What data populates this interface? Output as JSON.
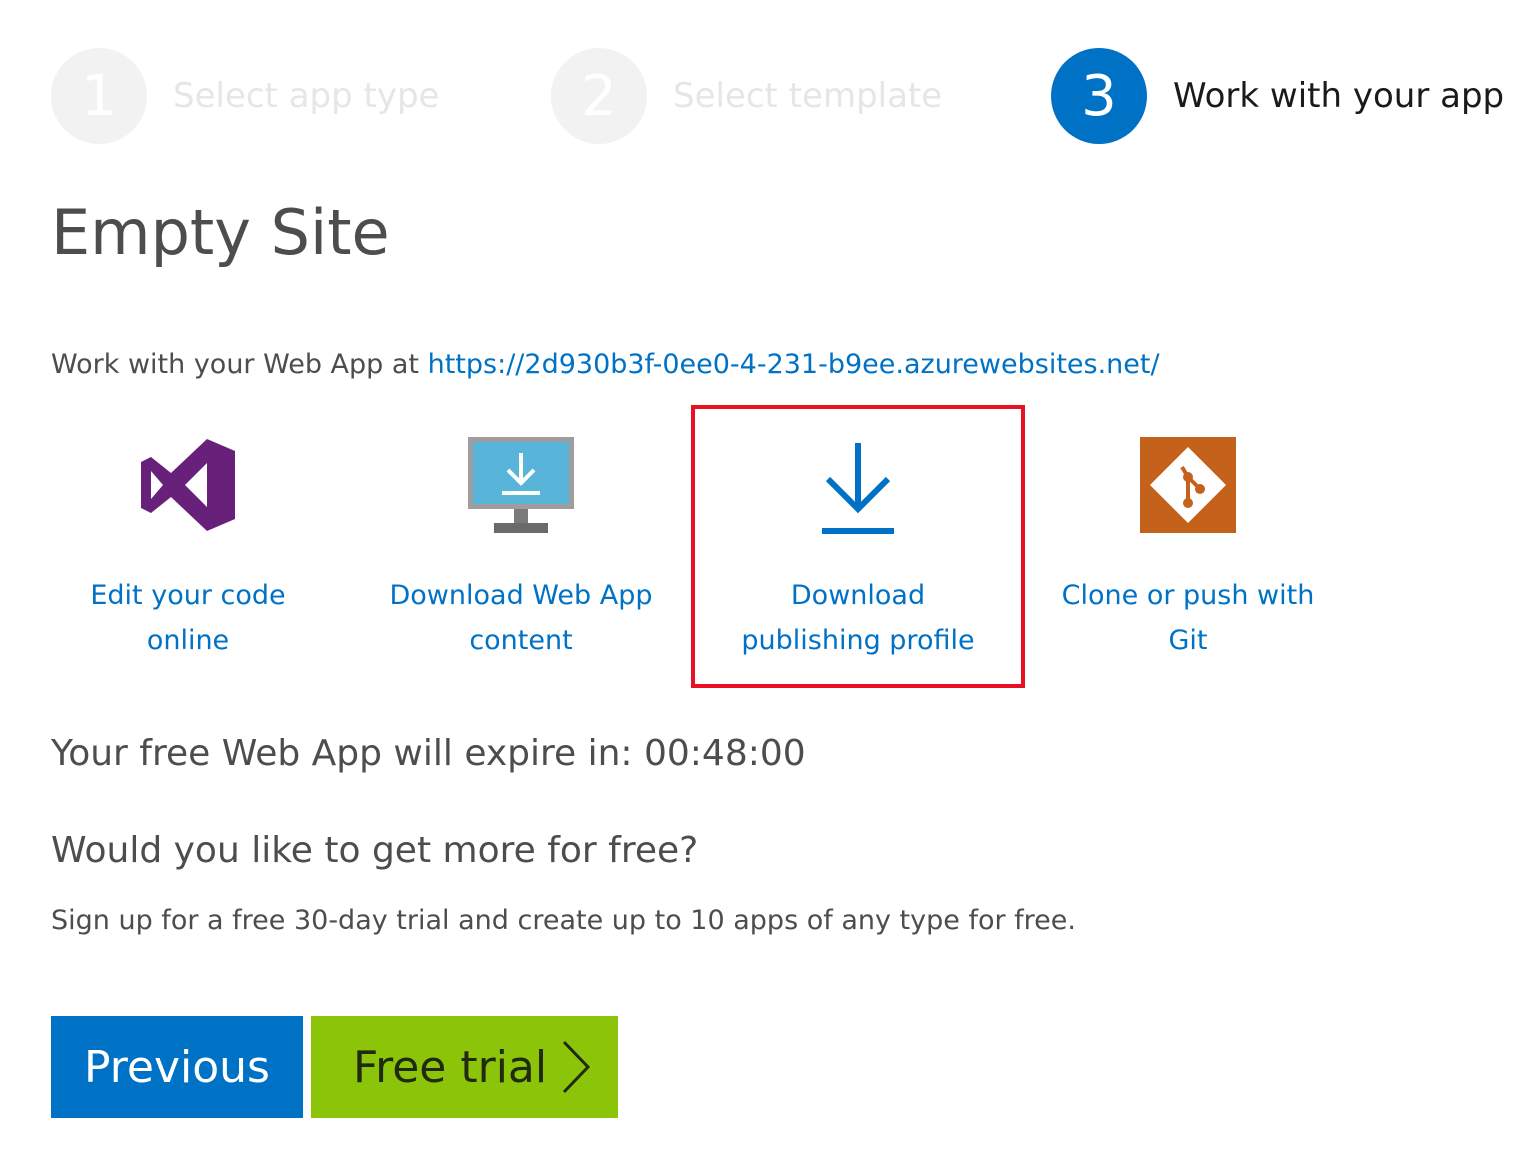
{
  "wizard": {
    "steps": [
      {
        "number": "1",
        "label": "Select app type",
        "state": "inactive"
      },
      {
        "number": "2",
        "label": "Select template",
        "state": "inactive"
      },
      {
        "number": "3",
        "label": "Work with your app",
        "state": "active"
      }
    ]
  },
  "page_title": "Empty Site",
  "work_with": {
    "prefix": "Work with your Web App at ",
    "url": "https://2d930b3f-0ee0-4-231-b9ee.azurewebsites.net/"
  },
  "actions": [
    {
      "label": "Edit your code\nonline",
      "icon": "visual-studio-icon"
    },
    {
      "label": "Download Web App\ncontent",
      "icon": "monitor-download-icon"
    },
    {
      "label": "Download\npublishing profile",
      "icon": "download-arrow-icon",
      "highlighted": true
    },
    {
      "label": "Clone or push with\nGit",
      "icon": "git-icon"
    }
  ],
  "expire_text": "Your free Web App will expire in: 00:48:00",
  "more_heading": "Would you like to get more for free?",
  "signup_text": "Sign up for a free 30-day trial and create up to 10 apps of any type for free.",
  "buttons": {
    "previous": "Previous",
    "free_trial": "Free trial"
  },
  "colors": {
    "accent_blue": "#0072c6",
    "trial_green": "#8cc40a",
    "highlight_red": "#e81123",
    "vs_purple": "#68217a",
    "git_orange": "#c4621c"
  }
}
